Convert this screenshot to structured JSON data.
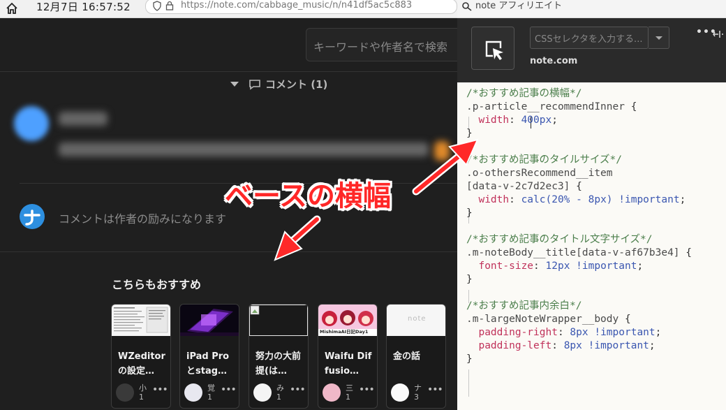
{
  "taskbar": {
    "date": "12月7日",
    "time": "16:57:52"
  },
  "browser": {
    "url": "https://note.com/cabbage_music/n/n41df5ac5c883"
  },
  "page": {
    "search_placeholder": "キーワードや作者名で検索",
    "comments_header": "コメント (1)",
    "comment_placeholder": "コメントは作者の励みになります",
    "recommend_title": "こちらもおすすめ",
    "cards": [
      {
        "title": "WZeditorの設定…",
        "user": "小",
        "count": "1",
        "thumb": "doc"
      },
      {
        "title": "iPad Proとstag…",
        "user": "覚",
        "count": "1",
        "thumb": "ipad"
      },
      {
        "title": "努力の大前提(は…",
        "user": "み",
        "count": "1",
        "thumb": "broken"
      },
      {
        "title": "Waifu Diffusio…",
        "user": "三",
        "count": "1",
        "thumb": "anime"
      },
      {
        "title": "金の話",
        "user": "ナ",
        "count": "3",
        "thumb": "note"
      }
    ],
    "thumb_anime_caption": "MishimaAI日記Day1",
    "thumb_note_text": "note"
  },
  "devtools": {
    "window_title": "note アフィリエイト",
    "selector_placeholder": "CSSセレクタを入力する...",
    "domain": "note.com",
    "more": "•••",
    "code": [
      [
        {
          "t": "/*おすすめ記事の横幅*/",
          "c": "cmt"
        }
      ],
      [
        {
          "t": ".p-article__recommendInner ",
          "c": "sel"
        },
        {
          "t": "{",
          "c": "punc"
        }
      ],
      [
        {
          "t": "  width",
          "c": "prop"
        },
        {
          "t": ": ",
          "c": "punc"
        },
        {
          "t": "400px",
          "c": "val"
        },
        {
          "t": ";",
          "c": "punc"
        }
      ],
      [
        {
          "t": "}",
          "c": "punc"
        }
      ],
      [
        {
          "t": "",
          "c": "punc"
        }
      ],
      [
        {
          "t": "/*おすすめ記事のタイルサイズ*/",
          "c": "cmt"
        }
      ],
      [
        {
          "t": ".o-othersRecommend__item",
          "c": "sel"
        }
      ],
      [
        {
          "t": "[data-v-2c7d2ec3] ",
          "c": "sel"
        },
        {
          "t": "{",
          "c": "punc"
        }
      ],
      [
        {
          "t": "  width",
          "c": "prop"
        },
        {
          "t": ": ",
          "c": "punc"
        },
        {
          "t": "calc(20% - 8px) !important",
          "c": "val"
        },
        {
          "t": ";",
          "c": "punc"
        }
      ],
      [
        {
          "t": "}",
          "c": "punc"
        }
      ],
      [
        {
          "t": "",
          "c": "punc"
        }
      ],
      [
        {
          "t": "/*おすすめ記事のタイトル文字サイズ*/",
          "c": "cmt"
        }
      ],
      [
        {
          "t": ".m-noteBody__title[data-v-af67b3e4] ",
          "c": "sel"
        },
        {
          "t": "{",
          "c": "punc"
        }
      ],
      [
        {
          "t": "  font-size",
          "c": "prop"
        },
        {
          "t": ": ",
          "c": "punc"
        },
        {
          "t": "12px !important",
          "c": "val"
        },
        {
          "t": ";",
          "c": "punc"
        }
      ],
      [
        {
          "t": "}",
          "c": "punc"
        }
      ],
      [
        {
          "t": "",
          "c": "punc"
        }
      ],
      [
        {
          "t": "/*おすすめ記事内余白*/",
          "c": "cmt"
        }
      ],
      [
        {
          "t": ".m-largeNoteWrapper__body ",
          "c": "sel"
        },
        {
          "t": "{",
          "c": "punc"
        }
      ],
      [
        {
          "t": "  padding-right",
          "c": "prop"
        },
        {
          "t": ": ",
          "c": "punc"
        },
        {
          "t": "8px !important",
          "c": "val"
        },
        {
          "t": ";",
          "c": "punc"
        }
      ],
      [
        {
          "t": "  padding-left",
          "c": "prop"
        },
        {
          "t": ": ",
          "c": "punc"
        },
        {
          "t": "8px !important",
          "c": "val"
        },
        {
          "t": ";",
          "c": "punc"
        }
      ],
      [
        {
          "t": "}",
          "c": "punc"
        }
      ]
    ]
  },
  "annotation": {
    "label": "ベースの横幅",
    "color": "#ff2828"
  }
}
